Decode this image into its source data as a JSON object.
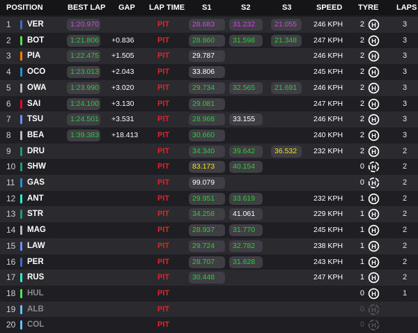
{
  "colors": {
    "purple": "#d444e8",
    "green": "#2ecc3a",
    "yellow": "#f2e21c",
    "white": "#ffffff",
    "pit_red": "#e0242a",
    "row_odd": "#2a2a2f",
    "row_even": "#1f1f23",
    "pill_bg": "#3e3e44"
  },
  "header": {
    "position": "POSITION",
    "best_lap": "BEST LAP",
    "gap": "GAP",
    "lap_time": "LAP TIME",
    "s1": "S1",
    "s2": "S2",
    "s3": "S3",
    "speed": "SPEED",
    "tyre": "TYRE",
    "laps": "LAPS"
  },
  "rows": [
    {
      "pos": "1",
      "driver": "VER",
      "team_color": "#3671c6",
      "best": "1:20.970",
      "best_c": "purple",
      "gap": "",
      "lap": "PIT",
      "s1": "28.683",
      "s1_c": "purple",
      "s2": "31.232",
      "s2_c": "purple",
      "s3": "21.055",
      "s3_c": "purple",
      "speed": "246 KPH",
      "tyre_n": "2",
      "tyre": "hard",
      "laps": "3"
    },
    {
      "pos": "2",
      "driver": "BOT",
      "team_color": "#52e252",
      "best": "1:21.806",
      "best_c": "green",
      "gap": "+0.836",
      "lap": "PIT",
      "s1": "28.860",
      "s1_c": "green",
      "s2": "31.598",
      "s2_c": "green",
      "s3": "21.348",
      "s3_c": "green",
      "speed": "247 KPH",
      "tyre_n": "2",
      "tyre": "hard",
      "laps": "3"
    },
    {
      "pos": "3",
      "driver": "PIA",
      "team_color": "#ff8000",
      "best": "1:22.475",
      "best_c": "green",
      "gap": "+1.505",
      "lap": "PIT",
      "s1": "29.787",
      "s1_c": "white",
      "s2": "",
      "s2_c": "",
      "s3": "",
      "s3_c": "",
      "speed": "246 KPH",
      "tyre_n": "2",
      "tyre": "hard",
      "laps": "3"
    },
    {
      "pos": "4",
      "driver": "OCO",
      "team_color": "#2293d1",
      "best": "1:23.013",
      "best_c": "green",
      "gap": "+2.043",
      "lap": "PIT",
      "s1": "33.806",
      "s1_c": "white",
      "s2": "",
      "s2_c": "",
      "s3": "",
      "s3_c": "",
      "speed": "245 KPH",
      "tyre_n": "2",
      "tyre": "hard",
      "laps": "3"
    },
    {
      "pos": "5",
      "driver": "OWA",
      "team_color": "#b6babd",
      "best": "1:23.990",
      "best_c": "green",
      "gap": "+3.020",
      "lap": "PIT",
      "s1": "29.734",
      "s1_c": "green",
      "s2": "32.565",
      "s2_c": "green",
      "s3": "21.691",
      "s3_c": "green",
      "speed": "246 KPH",
      "tyre_n": "2",
      "tyre": "hard",
      "laps": "3"
    },
    {
      "pos": "6",
      "driver": "SAI",
      "team_color": "#e8002d",
      "best": "1:24.100",
      "best_c": "green",
      "gap": "+3.130",
      "lap": "PIT",
      "s1": "29.081",
      "s1_c": "green",
      "s2": "",
      "s2_c": "",
      "s3": "",
      "s3_c": "",
      "speed": "247 KPH",
      "tyre_n": "2",
      "tyre": "hard",
      "laps": "3"
    },
    {
      "pos": "7",
      "driver": "TSU",
      "team_color": "#6692ff",
      "best": "1:24.501",
      "best_c": "green",
      "gap": "+3.531",
      "lap": "PIT",
      "s1": "28.968",
      "s1_c": "green",
      "s2": "33.155",
      "s2_c": "white",
      "s3": "",
      "s3_c": "",
      "speed": "246 KPH",
      "tyre_n": "2",
      "tyre": "hard",
      "laps": "3"
    },
    {
      "pos": "8",
      "driver": "BEA",
      "team_color": "#b6babd",
      "best": "1:39.383",
      "best_c": "green",
      "gap": "+18.413",
      "lap": "PIT",
      "s1": "30.660",
      "s1_c": "green",
      "s2": "",
      "s2_c": "",
      "s3": "",
      "s3_c": "",
      "speed": "240 KPH",
      "tyre_n": "2",
      "tyre": "hard",
      "laps": "3"
    },
    {
      "pos": "9",
      "driver": "DRU",
      "team_color": "#229971",
      "best": "",
      "best_c": "",
      "gap": "",
      "lap": "PIT",
      "s1": "34.340",
      "s1_c": "green",
      "s2": "39.642",
      "s2_c": "green",
      "s3": "36.532",
      "s3_c": "yellow",
      "speed": "232 KPH",
      "tyre_n": "2",
      "tyre": "hard",
      "laps": "2"
    },
    {
      "pos": "10",
      "driver": "SHW",
      "team_color": "#229971",
      "best": "",
      "best_c": "",
      "gap": "",
      "lap": "PIT",
      "s1": "83.173",
      "s1_c": "yellow",
      "s2": "40.154",
      "s2_c": "green",
      "s3": "",
      "s3_c": "",
      "speed": "",
      "tyre_n": "0",
      "tyre": "new",
      "laps": "2"
    },
    {
      "pos": "11",
      "driver": "GAS",
      "team_color": "#2293d1",
      "best": "",
      "best_c": "",
      "gap": "",
      "lap": "PIT",
      "s1": "99.079",
      "s1_c": "white",
      "s2": "",
      "s2_c": "",
      "s3": "",
      "s3_c": "",
      "speed": "",
      "tyre_n": "0",
      "tyre": "new",
      "laps": "2"
    },
    {
      "pos": "12",
      "driver": "ANT",
      "team_color": "#27f4d2",
      "best": "",
      "best_c": "",
      "gap": "",
      "lap": "PIT",
      "s1": "29.951",
      "s1_c": "green",
      "s2": "33.619",
      "s2_c": "green",
      "s3": "",
      "s3_c": "",
      "speed": "232 KPH",
      "tyre_n": "1",
      "tyre": "hard",
      "laps": "2"
    },
    {
      "pos": "13",
      "driver": "STR",
      "team_color": "#229971",
      "best": "",
      "best_c": "",
      "gap": "",
      "lap": "PIT",
      "s1": "34.258",
      "s1_c": "green",
      "s2": "41.061",
      "s2_c": "white",
      "s3": "",
      "s3_c": "",
      "speed": "229 KPH",
      "tyre_n": "1",
      "tyre": "hard",
      "laps": "2"
    },
    {
      "pos": "14",
      "driver": "MAG",
      "team_color": "#b6babd",
      "best": "",
      "best_c": "",
      "gap": "",
      "lap": "PIT",
      "s1": "28.937",
      "s1_c": "green",
      "s2": "31.770",
      "s2_c": "green",
      "s3": "",
      "s3_c": "",
      "speed": "245 KPH",
      "tyre_n": "1",
      "tyre": "hard",
      "laps": "2"
    },
    {
      "pos": "15",
      "driver": "LAW",
      "team_color": "#6692ff",
      "best": "",
      "best_c": "",
      "gap": "",
      "lap": "PIT",
      "s1": "29.724",
      "s1_c": "green",
      "s2": "32.782",
      "s2_c": "green",
      "s3": "",
      "s3_c": "",
      "speed": "238 KPH",
      "tyre_n": "1",
      "tyre": "hard",
      "laps": "2"
    },
    {
      "pos": "16",
      "driver": "PER",
      "team_color": "#3671c6",
      "best": "",
      "best_c": "",
      "gap": "",
      "lap": "PIT",
      "s1": "28.707",
      "s1_c": "green",
      "s2": "31.628",
      "s2_c": "green",
      "s3": "",
      "s3_c": "",
      "speed": "243 KPH",
      "tyre_n": "1",
      "tyre": "hard",
      "laps": "2"
    },
    {
      "pos": "17",
      "driver": "RUS",
      "team_color": "#27f4d2",
      "best": "",
      "best_c": "",
      "gap": "",
      "lap": "PIT",
      "s1": "30.448",
      "s1_c": "green",
      "s2": "",
      "s2_c": "",
      "s3": "",
      "s3_c": "",
      "speed": "247 KPH",
      "tyre_n": "1",
      "tyre": "hard",
      "laps": "2"
    },
    {
      "pos": "18",
      "driver": "HUL",
      "team_color": "#52e252",
      "best": "",
      "best_c": "",
      "gap": "",
      "lap": "PIT",
      "s1": "",
      "s1_c": "",
      "s2": "",
      "s2_c": "",
      "s3": "",
      "s3_c": "",
      "speed": "",
      "tyre_n": "0",
      "tyre": "hard",
      "laps": "1"
    },
    {
      "pos": "19",
      "driver": "ALB",
      "team_color": "#64c4ff",
      "best": "",
      "best_c": "",
      "gap": "",
      "lap": "PIT",
      "s1": "",
      "s1_c": "",
      "s2": "",
      "s2_c": "",
      "s3": "",
      "s3_c": "",
      "speed": "",
      "tyre_n": "0",
      "tyre": "dim",
      "laps": ""
    },
    {
      "pos": "20",
      "driver": "COL",
      "team_color": "#64c4ff",
      "best": "",
      "best_c": "",
      "gap": "",
      "lap": "PIT",
      "s1": "",
      "s1_c": "",
      "s2": "",
      "s2_c": "",
      "s3": "",
      "s3_c": "",
      "speed": "",
      "tyre_n": "0",
      "tyre": "dim",
      "laps": ""
    }
  ]
}
